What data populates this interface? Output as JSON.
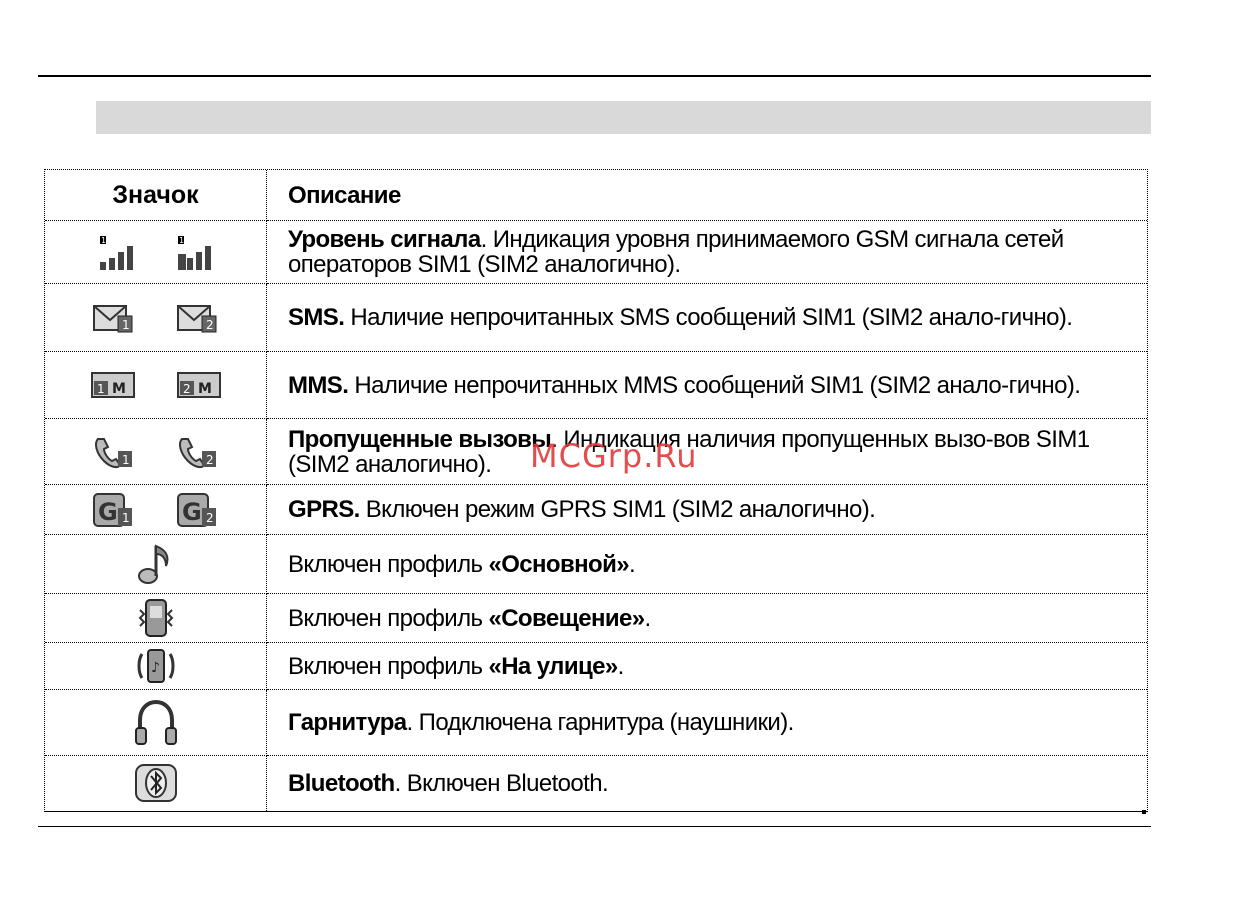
{
  "table": {
    "header": {
      "icon": "Значок",
      "description": "Описание"
    },
    "rows": [
      {
        "icons": [
          "signal-sim1-icon",
          "signal-sim2-icon"
        ],
        "bold": "Уровень сигнала",
        "text": ". Индикация уровня принимаемого GSM сигнала сетей операторов SIM1 (SIM2 аналогично)."
      },
      {
        "icons": [
          "sms-sim1-icon",
          "sms-sim2-icon"
        ],
        "bold": "SMS.",
        "text": " Наличие непрочитанных SMS сообщений SIM1 (SIM2 анало-гично)."
      },
      {
        "icons": [
          "mms-sim1-icon",
          "mms-sim2-icon"
        ],
        "bold": "MMS.",
        "text": " Наличие непрочитанных MMS сообщений SIM1 (SIM2 анало-гично)."
      },
      {
        "icons": [
          "missed-call-sim1-icon",
          "missed-call-sim2-icon"
        ],
        "bold": "Пропущенные вызовы",
        "text": ". Индикация наличия пропущенных вызо-вов SIM1 (SIM2 аналогично)."
      },
      {
        "icons": [
          "gprs-sim1-icon",
          "gprs-sim2-icon"
        ],
        "bold": "GPRS.",
        "text": " Включен режим GPRS SIM1 (SIM2 аналогично)."
      },
      {
        "icons": [
          "music-note-icon"
        ],
        "prefix": "Включен профиль ",
        "bold": "«Основной»",
        "text": "."
      },
      {
        "icons": [
          "meeting-phone-icon"
        ],
        "prefix": "Включен профиль ",
        "bold": "«Совещение»",
        "text": "."
      },
      {
        "icons": [
          "outdoor-phone-icon"
        ],
        "prefix": "Включен профиль ",
        "bold": "«На улице»",
        "text": "."
      },
      {
        "icons": [
          "headset-icon"
        ],
        "bold": "Гарнитура",
        "text": ". Подключена гарнитура (наушники)."
      },
      {
        "icons": [
          "bluetooth-icon"
        ],
        "bold": "Bluetooth",
        "text": ". Включен Bluetooth."
      }
    ]
  },
  "watermark": "MCGrp.Ru"
}
